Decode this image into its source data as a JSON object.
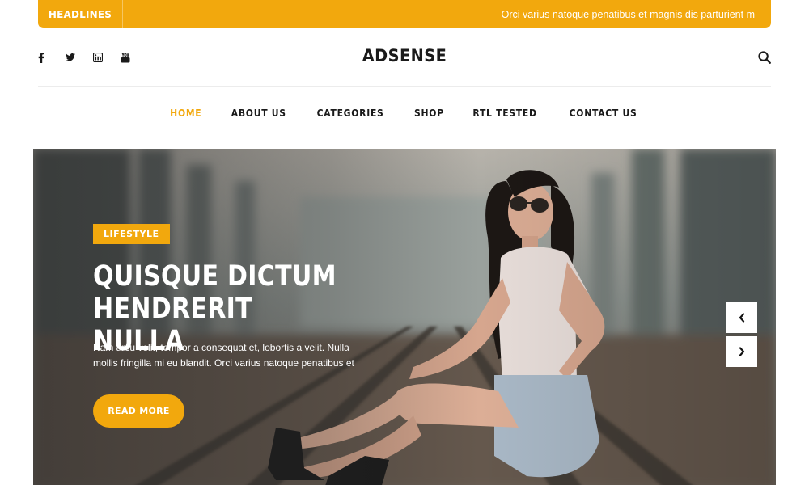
{
  "headlines": {
    "label": "HEADLINES",
    "ticker_text": "Orci varius natoque penatibus et magnis dis parturient m"
  },
  "header": {
    "social_icons": [
      "facebook-icon",
      "twitter-icon",
      "linkedin-icon",
      "youtube-icon"
    ],
    "logo": "ADSENSE",
    "search_icon": "search-icon"
  },
  "nav": {
    "items": [
      {
        "label": "HOME",
        "active": true
      },
      {
        "label": "ABOUT US",
        "active": false
      },
      {
        "label": "CATEGORIES",
        "active": false
      },
      {
        "label": "SHOP",
        "active": false
      },
      {
        "label": "RTL TESTED",
        "active": false
      },
      {
        "label": "CONTACT US",
        "active": false
      }
    ]
  },
  "hero": {
    "category": "LIFESTYLE",
    "title": "QUISQUE DICTUM HENDRERIT NULLA",
    "excerpt": "Nam arcu velit, tempor a consequat et, lobortis a velit. Nulla mollis fringilla mi eu blandit. Orci varius natoque penatibus et",
    "button": "READ MORE",
    "prev_icon": "chevron-left-icon",
    "next_icon": "chevron-right-icon"
  },
  "colors": {
    "accent": "#f2a80d",
    "text": "#1a1a1a"
  }
}
